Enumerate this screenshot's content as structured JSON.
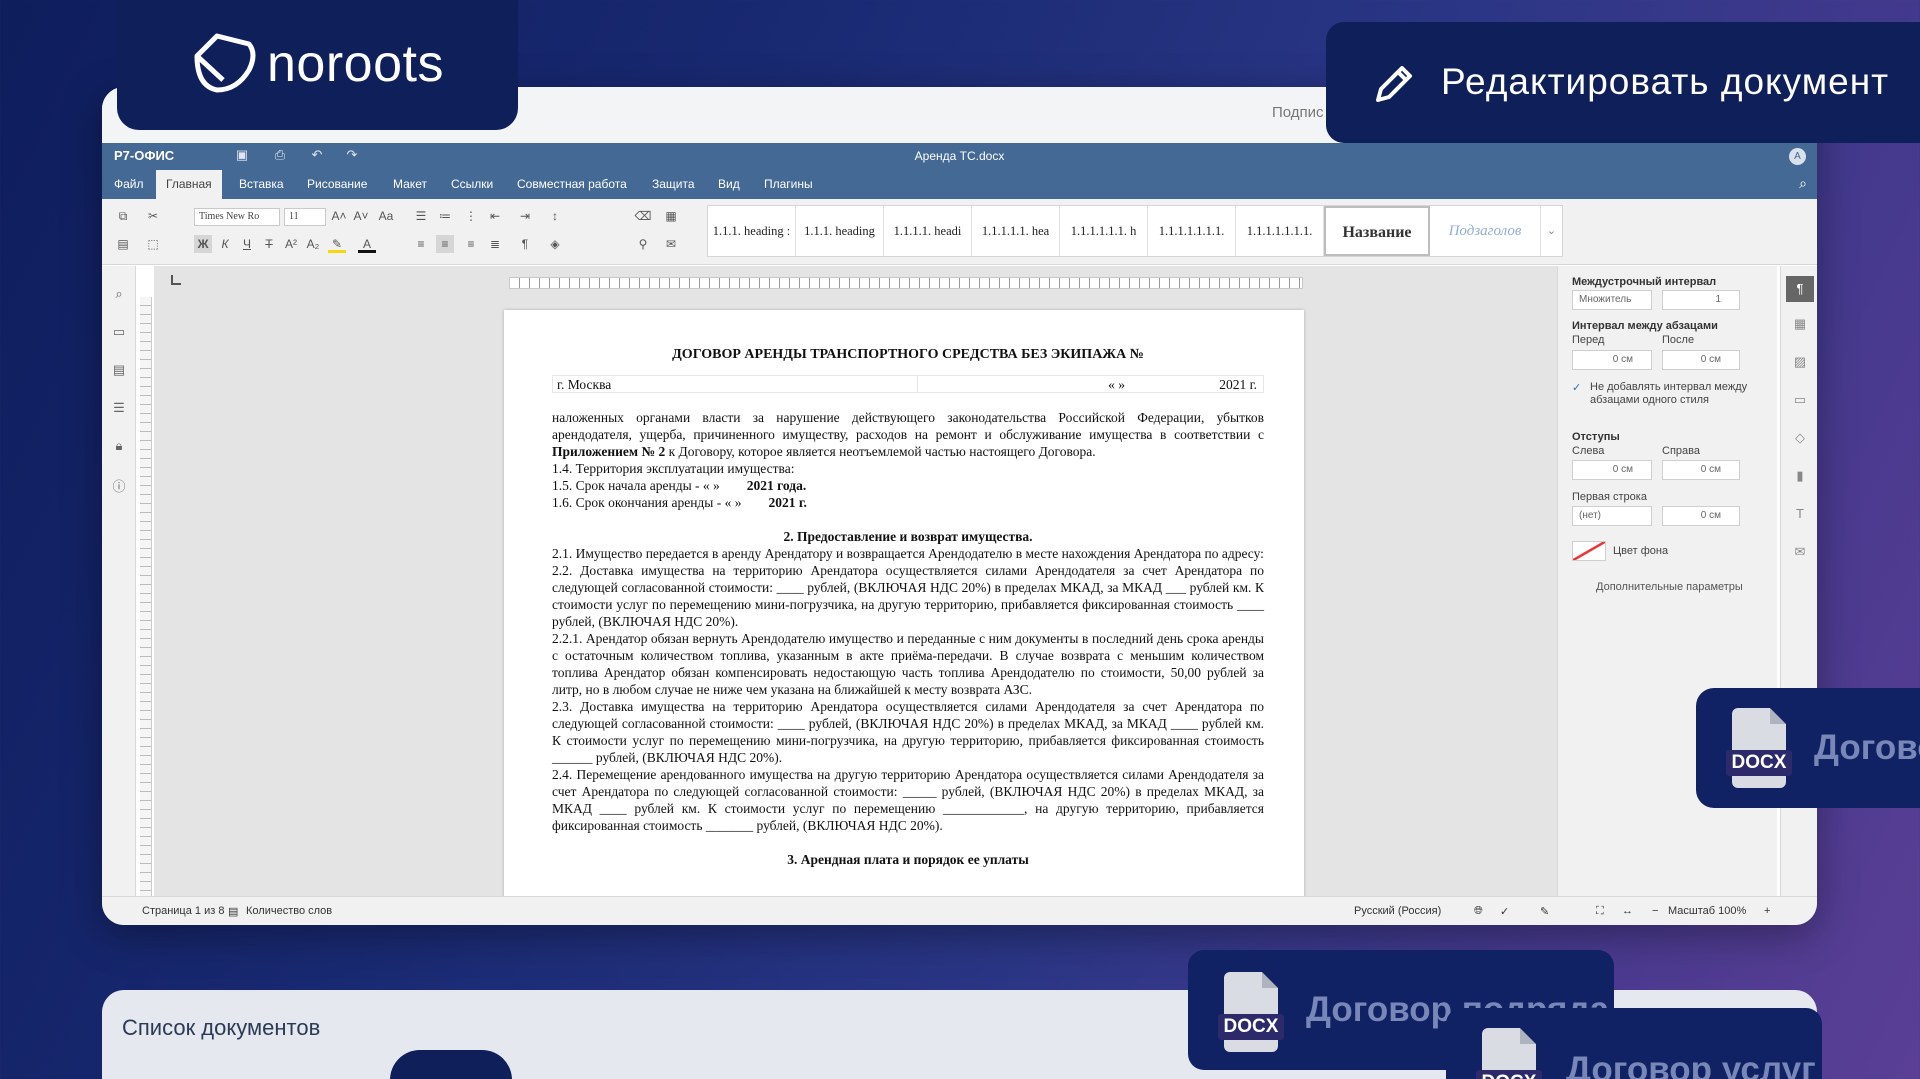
{
  "brand": {
    "logo_text": "noroots"
  },
  "edit_banner": {
    "label": "Редактировать документ"
  },
  "topstrip": {
    "sign_label": "Подпис"
  },
  "app": {
    "name": "Р7-ОФИС",
    "doc_title": "Аренда ТС.docx",
    "user_initial": "А"
  },
  "menu": {
    "tabs": [
      "Файл",
      "Главная",
      "Вставка",
      "Рисование",
      "Макет",
      "Ссылки",
      "Совместная работа",
      "Защита",
      "Вид",
      "Плагины"
    ],
    "active": "Главная"
  },
  "toolbar": {
    "font_name": "Times New Ro",
    "font_size": "11",
    "styles": [
      "1.1.1. heading :",
      "1.1.1. heading",
      "1.1.1.1. headi",
      "1.1.1.1.1. hea",
      "1.1.1.1.1.1. h",
      "1.1.1.1.1.1.1.",
      "1.1.1.1.1.1.1."
    ],
    "style_title": "Название",
    "style_subtitle": "Подзаголов"
  },
  "document": {
    "title": "ДОГОВОР АРЕНДЫ ТРАНСПОРТНОГО СРЕДСТВА БЕЗ ЭКИПАЖА №",
    "city": "г. Москва",
    "date_quotes": "«   »",
    "year": "2021 г.",
    "p1": "наложенных органами власти за нарушение действующего законодательства Российской Федерации, убытков арендодателя, ущерба, причиненного имуществу, расходов на ремонт и обслуживание имущества в соответствии с",
    "p1_bold": "Приложением № 2",
    "p1_tail": "к Договору, которое является неотъемлемой частью настоящего Договора.",
    "p_1_4": "1.4. Территория эксплуатации имущества:",
    "p_1_5": "1.5. Срок начала аренды - «   »",
    "p_1_5_bold": "2021 года.",
    "p_1_6": "1.6. Срок окончания аренды - «   »",
    "p_1_6_bold": "2021 г.",
    "section2": "2. Предоставление и возврат имущества.",
    "p_2_1": "2.1. Имущество передается в аренду Арендатору и возвращается Арендодателю в месте нахождения Арендатора по адресу:",
    "p_2_2": "2.2. Доставка имущества на территорию Арендатора осуществляется силами Арендодателя за счет Арендатора по следующей согласованной стоимости: ____ рублей, (ВКЛЮЧАЯ НДС 20%) в пределах МКАД, за МКАД ___ рублей км. К стоимости услуг по перемещению мини-погрузчика, на другую территорию, прибавляется фиксированная стоимость ____ рублей, (ВКЛЮЧАЯ НДС 20%).",
    "p_2_2_1": "2.2.1. Арендатор обязан вернуть Арендодателю имущество и переданные с ним документы в последний день срока аренды с остаточным количеством топлива, указанным в акте приёма-передачи. В случае возврата с меньшим количеством топлива Арендатор обязан компенсировать недостающую часть топлива Арендодателю по стоимости, 50,00 рублей за литр, но в любом случае не ниже чем указана на ближайшей к месту возврата АЗС.",
    "p_2_3": "2.3. Доставка имущества на территорию Арендатора осуществляется силами Арендодателя за счет Арендатора по следующей согласованной стоимости: ____ рублей, (ВКЛЮЧАЯ НДС 20%) в пределах МКАД, за МКАД ____ рублей км. К стоимости услуг по перемещению мини-погрузчика, на другую территорию, прибавляется фиксированная стоимость ______ рублей, (ВКЛЮЧАЯ НДС 20%).",
    "p_2_4": "2.4. Перемещение арендованного имущества на другую территорию Арендатора осуществляется силами Арендодателя за счет Арендатора по следующей согласованной стоимости: _____ рублей, (ВКЛЮЧАЯ НДС 20%) в пределах МКАД, за МКАД ____ рублей км. К стоимости услуг по перемещению ____________, на другую территорию, прибавляется фиксированная стоимость _______ рублей, (ВКЛЮЧАЯ НДС 20%).",
    "section3": "3. Арендная плата и порядок ее уплаты"
  },
  "paragraph_panel": {
    "line_spacing_label": "Междустрочный интервал",
    "line_spacing_mode": "Множитель",
    "line_spacing_value": "1",
    "para_spacing_label": "Интервал между абзацами",
    "before_label": "Перед",
    "after_label": "После",
    "before_value": "0 см",
    "after_value": "0 см",
    "no_spacing_same_style": "Не добавлять интервал между абзацами одного стиля",
    "indents_label": "Отступы",
    "left_label": "Слева",
    "right_label": "Справа",
    "left_value": "0 см",
    "right_value": "0 см",
    "first_line_label": "Первая строка",
    "first_line_mode": "(нет)",
    "first_line_value": "0 см",
    "bg_color_label": "Цвет фона",
    "advanced_link": "Дополнительные параметры"
  },
  "statusbar": {
    "page_info": "Страница 1 из 8",
    "word_count": "Количество слов",
    "language": "Русский (Россия)",
    "zoom": "Масштаб 100%"
  },
  "docs": {
    "list_title": "Список документов",
    "badge": "DOCX",
    "doc1": "Догово",
    "doc2": "Договор подряда",
    "doc3": "Договор услуг"
  },
  "colors": {
    "window_header": "#446995",
    "overlay_card": "#0f1f5a",
    "background": "#1a2a73"
  }
}
